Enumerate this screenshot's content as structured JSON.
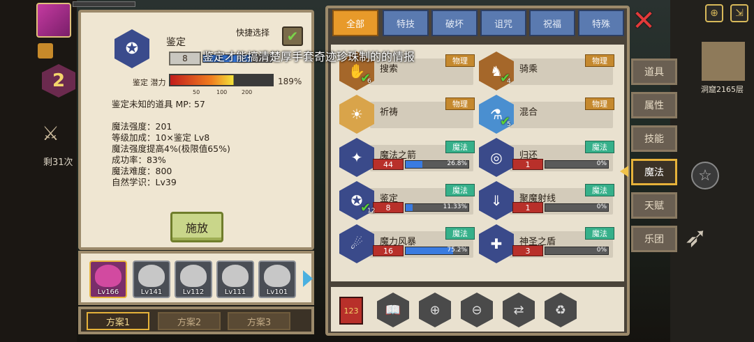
{
  "hud": {
    "level_badge": "2",
    "swords_count": "剩31次",
    "cave_floor": "洞窟2165层"
  },
  "detail": {
    "title": "鉴定",
    "quick_select_label": "快捷选择",
    "level": "8",
    "level_progress_pct": 70,
    "tooltip": "鉴定才能搞清楚厚手套奇迹珍珠制的的情报",
    "potential_label": "鉴定  潜力",
    "potential_pct": "189%",
    "potential_ticks": [
      "50",
      "100",
      "200"
    ],
    "desc_line": "鉴定未知的道具   MP:  57",
    "stats": [
      "魔法强度：201",
      "   等级加成：10×鉴定 Lv8",
      "   魔法强度提高4%(极限值65%)",
      "成功率：83%",
      "   魔法难度：800",
      "   自然学识：Lv39"
    ],
    "cast_label": "施放"
  },
  "heroes": [
    {
      "level": "Lv166",
      "active": true
    },
    {
      "level": "Lv141",
      "active": false
    },
    {
      "level": "Lv112",
      "active": false
    },
    {
      "level": "Lv111",
      "active": false
    },
    {
      "level": "Lv101",
      "active": false
    }
  ],
  "plans": [
    "方案1",
    "方案2",
    "方案3"
  ],
  "tabs": [
    "全部",
    "特技",
    "破坏",
    "诅咒",
    "祝福",
    "特殊"
  ],
  "skills": [
    {
      "name": "搜索",
      "tag": "物理",
      "tag_type": "phys",
      "icon": "search-hand-icon",
      "icon_style": "brown",
      "checked": true,
      "sub": "6"
    },
    {
      "name": "骑乘",
      "tag": "物理",
      "tag_type": "phys",
      "icon": "horse-icon",
      "icon_style": "brown",
      "checked": true,
      "sub": "4"
    },
    {
      "name": "祈祷",
      "tag": "物理",
      "tag_type": "phys",
      "icon": "pray-icon",
      "icon_style": "cream"
    },
    {
      "name": "混合",
      "tag": "物理",
      "tag_type": "phys",
      "icon": "flask-icon",
      "icon_style": "light",
      "checked": true,
      "sub": "5"
    },
    {
      "name": "魔法之箭",
      "tag": "魔法",
      "tag_type": "magic",
      "icon": "magic-arrow-icon",
      "icon_style": "white",
      "level": "44",
      "progress": 26.8,
      "progress_text": "26.8%"
    },
    {
      "name": "归还",
      "tag": "魔法",
      "tag_type": "magic",
      "icon": "return-icon",
      "icon_style": "white",
      "level": "1",
      "progress": 0,
      "progress_text": "0%"
    },
    {
      "name": "鉴定",
      "tag": "魔法",
      "tag_type": "magic",
      "icon": "identify-icon",
      "icon_style": "white",
      "level": "8",
      "progress": 11.33,
      "progress_text": "11.33%",
      "checked": true,
      "sub": "12"
    },
    {
      "name": "聚魔射线",
      "tag": "魔法",
      "tag_type": "magic",
      "icon": "ray-icon",
      "icon_style": "white",
      "level": "1",
      "progress": 0,
      "progress_text": "0%"
    },
    {
      "name": "魔力风暴",
      "tag": "魔法",
      "tag_type": "magic",
      "icon": "storm-icon",
      "icon_style": "white",
      "level": "16",
      "progress": 75.2,
      "progress_text": "75.2%"
    },
    {
      "name": "神圣之盾",
      "tag": "魔法",
      "tag_type": "magic",
      "icon": "holy-shield-icon",
      "icon_style": "white",
      "level": "3",
      "progress": 0,
      "progress_text": "0%"
    }
  ],
  "categories": [
    "道具",
    "属性",
    "技能",
    "魔法",
    "天赋",
    "乐团"
  ],
  "active_category": "魔法",
  "tools": [
    "sort-number-icon",
    "book-icon",
    "search-plus-icon",
    "search-minus-icon",
    "swap-icon",
    "recycle-icon"
  ],
  "colors": {
    "accent": "#e89a2a",
    "magic_tag": "#36b08a",
    "phys_tag": "#c5892f"
  }
}
